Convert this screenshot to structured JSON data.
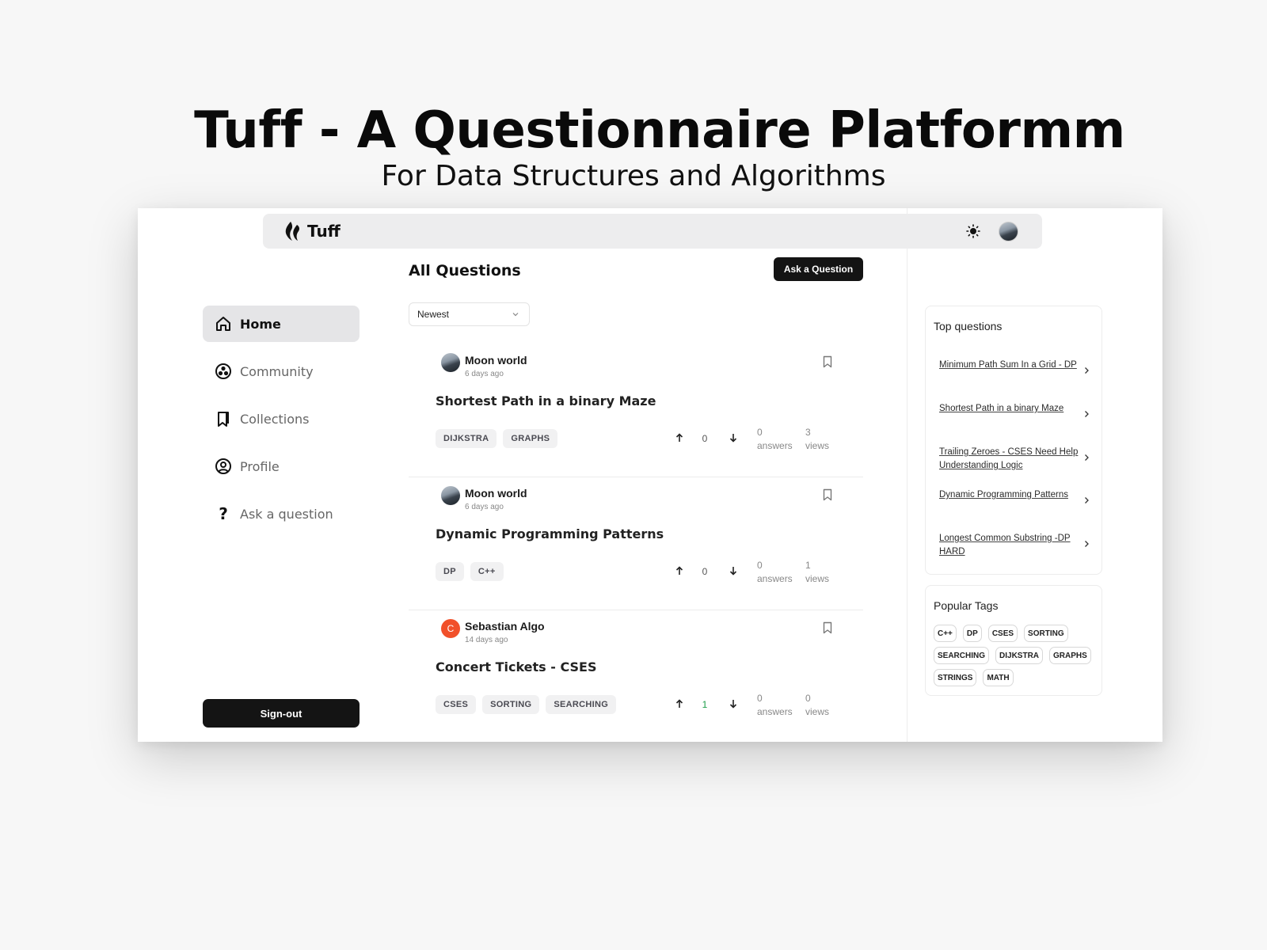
{
  "hero": {
    "title": "Tuff - A Questionnaire Platformm",
    "subtitle": "For Data Structures and Algorithms"
  },
  "app": {
    "logo_text": "Tuff",
    "theme_icon": "sun-icon",
    "avatar_icon": "user-avatar"
  },
  "sidebar": {
    "items": [
      {
        "label": "Home",
        "icon": "home-icon",
        "active": true
      },
      {
        "label": "Community",
        "icon": "community-icon",
        "active": false
      },
      {
        "label": "Collections",
        "icon": "bookmark-icon",
        "active": false
      },
      {
        "label": "Profile",
        "icon": "user-circle-icon",
        "active": false
      },
      {
        "label": "Ask a question",
        "icon": "question-icon",
        "active": false
      }
    ],
    "signout_label": "Sign-out"
  },
  "main": {
    "title": "All Questions",
    "ask_button": "Ask a Question",
    "filter_value": "Newest",
    "questions": [
      {
        "author": "Moon world",
        "time": "6 days ago",
        "title": "Shortest Path in a binary Maze",
        "tags": [
          "DIJKSTRA",
          "GRAPHS"
        ],
        "votes": "0",
        "answers_count": "0",
        "answers_label": "answers",
        "views_count": "3",
        "views_label": "views"
      },
      {
        "author": "Moon world",
        "time": "6 days ago",
        "title": "Dynamic Programming Patterns",
        "tags": [
          "DP",
          "C++"
        ],
        "votes": "0",
        "answers_count": "0",
        "answers_label": "answers",
        "views_count": "1",
        "views_label": "views"
      },
      {
        "author": "Sebastian Algo",
        "avatar_letter": "C",
        "time": "14 days ago",
        "title": "Concert Tickets - CSES",
        "tags": [
          "CSES",
          "SORTING",
          "SEARCHING"
        ],
        "votes": "1",
        "answers_count": "0",
        "answers_label": "answers",
        "views_count": "0",
        "views_label": "views"
      }
    ]
  },
  "right": {
    "top_questions_title": "Top questions",
    "top_questions": [
      "Minimum Path Sum In a Grid - DP",
      "Shortest Path in a binary Maze",
      "Trailing Zeroes - CSES Need Help Understanding Logic",
      "Dynamic Programming Patterns",
      "Longest Common Substring -DP HARD"
    ],
    "popular_tags_title": "Popular Tags",
    "popular_tags": [
      "C++",
      "DP",
      "CSES",
      "SORTING",
      "SEARCHING",
      "DIJKSTRA",
      "GRAPHS",
      "STRINGS",
      "MATH"
    ]
  },
  "colors": {
    "accent_dark": "#141414",
    "active_bg": "#e5e5e7",
    "positive_vote": "#1e9e4a",
    "letter_avatar": "#f1502a"
  }
}
